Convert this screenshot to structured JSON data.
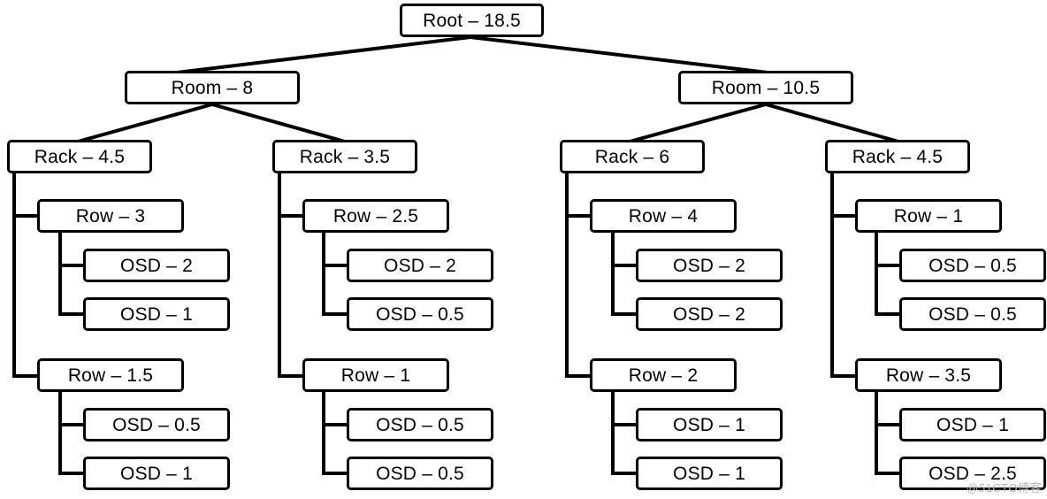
{
  "diagram": {
    "type": "crush-map-tree",
    "watermark": "@51CTO博客",
    "nodes": {
      "root": {
        "label": "Root – 18.5",
        "kind": "root",
        "weight": 18.5
      },
      "room_left": {
        "label": "Room – 8",
        "kind": "room",
        "weight": 8
      },
      "room_right": {
        "label": "Room – 10.5",
        "kind": "room",
        "weight": 10.5
      },
      "rack_1": {
        "label": "Rack – 4.5",
        "kind": "rack",
        "weight": 4.5
      },
      "rack_2": {
        "label": "Rack – 3.5",
        "kind": "rack",
        "weight": 3.5
      },
      "rack_3": {
        "label": "Rack – 6",
        "kind": "rack",
        "weight": 6
      },
      "rack_4": {
        "label": "Rack – 4.5",
        "kind": "rack",
        "weight": 4.5
      },
      "row_1a": {
        "label": "Row – 3",
        "kind": "row",
        "weight": 3
      },
      "row_1b": {
        "label": "Row – 1.5",
        "kind": "row",
        "weight": 1.5
      },
      "row_2a": {
        "label": "Row – 2.5",
        "kind": "row",
        "weight": 2.5
      },
      "row_2b": {
        "label": "Row – 1",
        "kind": "row",
        "weight": 1
      },
      "row_3a": {
        "label": "Row – 4",
        "kind": "row",
        "weight": 4
      },
      "row_3b": {
        "label": "Row – 2",
        "kind": "row",
        "weight": 2
      },
      "row_4a": {
        "label": "Row – 1",
        "kind": "row",
        "weight": 1
      },
      "row_4b": {
        "label": "Row – 3.5",
        "kind": "row",
        "weight": 3.5
      },
      "osd_1a1": {
        "label": "OSD – 2",
        "kind": "osd",
        "weight": 2
      },
      "osd_1a2": {
        "label": "OSD – 1",
        "kind": "osd",
        "weight": 1
      },
      "osd_1b1": {
        "label": "OSD – 0.5",
        "kind": "osd",
        "weight": 0.5
      },
      "osd_1b2": {
        "label": "OSD – 1",
        "kind": "osd",
        "weight": 1
      },
      "osd_2a1": {
        "label": "OSD – 2",
        "kind": "osd",
        "weight": 2
      },
      "osd_2a2": {
        "label": "OSD – 0.5",
        "kind": "osd",
        "weight": 0.5
      },
      "osd_2b1": {
        "label": "OSD – 0.5",
        "kind": "osd",
        "weight": 0.5
      },
      "osd_2b2": {
        "label": "OSD – 0.5",
        "kind": "osd",
        "weight": 0.5
      },
      "osd_3a1": {
        "label": "OSD – 2",
        "kind": "osd",
        "weight": 2
      },
      "osd_3a2": {
        "label": "OSD – 2",
        "kind": "osd",
        "weight": 2
      },
      "osd_3b1": {
        "label": "OSD – 1",
        "kind": "osd",
        "weight": 1
      },
      "osd_3b2": {
        "label": "OSD – 1",
        "kind": "osd",
        "weight": 1
      },
      "osd_4a1": {
        "label": "OSD – 0.5",
        "kind": "osd",
        "weight": 0.5
      },
      "osd_4a2": {
        "label": "OSD – 0.5",
        "kind": "osd",
        "weight": 0.5
      },
      "osd_4b1": {
        "label": "OSD – 1",
        "kind": "osd",
        "weight": 1
      },
      "osd_4b2": {
        "label": "OSD – 2.5",
        "kind": "osd",
        "weight": 2.5
      }
    }
  }
}
